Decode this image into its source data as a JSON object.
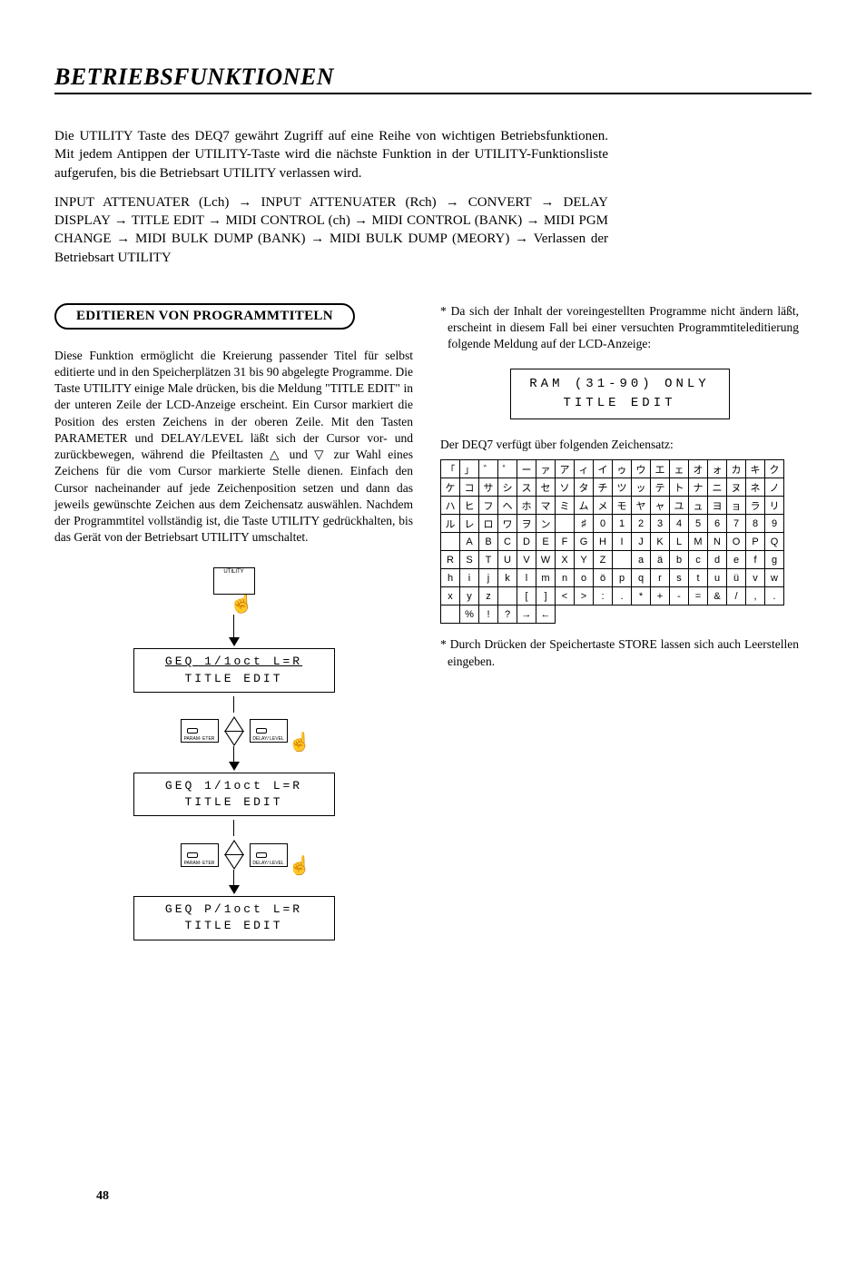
{
  "page_title": "BETRIEBSFUNKTIONEN",
  "page_number": "48",
  "intro": {
    "p1": "Die UTILITY Taste des DEQ7 gewährt Zugriff auf eine Reihe von wichtigen Betriebsfunktionen. Mit jedem Antippen der UTILITY-Taste wird die nächste Funktion in der UTILITY-Funktionsliste aufgerufen, bis die Betriebsart UTILITY verlassen wird.",
    "chain": "INPUT ATTENUATER (Lch) → INPUT ATTENUATER (Rch) → CONVERT → DELAY DISPLAY → TITLE EDIT → MIDI CONTROL (ch) → MIDI CONTROL (BANK) → MIDI PGM CHANGE → MIDI BULK DUMP (BANK) → MIDI BULK DUMP (MEORY) → Verlassen der Betriebsart UTILITY"
  },
  "section": {
    "heading": "EDITIEREN VON PROGRAMMTITELN",
    "body": "Diese Funktion ermöglicht die Kreierung passender Titel für selbst editierte und in den Speicherplätzen 31 bis 90 abgelegte Programme. Die Taste UTILITY einige Male drücken, bis die Meldung \"TITLE EDIT\" in der unteren Zeile der LCD-Anzeige erscheint. Ein Cursor markiert die Position des ersten Zeichens in der oberen Zeile. Mit den Tasten PARAMETER und DELAY/LEVEL läßt sich der Cursor vor- und zurückbewegen, während die Pfeiltasten △ und ▽ zur Wahl eines Zeichens für die vom Cursor markierte Stelle dienen. Einfach den Cursor nacheinander auf jede Zeichenposition setzen und dann das jeweils gewünschte Zeichen aus dem Zeichensatz auswählen. Nachdem der Programmtitel vollständig ist, die Taste UTILITY gedrückhalten, bis das Gerät von der Betriebsart UTILITY umschaltet."
  },
  "right": {
    "note": "* Da sich der Inhalt der voreingestellten Programme nicht ändern läßt, erscheint in diesem Fall bei einer versuchten Programmtiteleditierung folgende Meldung auf der LCD-Anzeige:",
    "lcd_line1": "RAM (31-90)  ONLY",
    "lcd_line2": "TITLE EDIT",
    "charset_intro": "Der DEQ7 verfügt über folgenden Zeichensatz:",
    "footnote": "* Durch Drücken der Speichertaste STORE lassen sich auch Leerstellen eingeben."
  },
  "charset_rows": [
    [
      "「",
      "」",
      "゛",
      "゜",
      "ー",
      "ァ",
      "ア",
      "ィ",
      "イ",
      "ゥ",
      "ウ",
      "エ",
      "ェ",
      "オ",
      "ォ",
      "カ",
      "キ",
      "ク"
    ],
    [
      "ケ",
      "コ",
      "サ",
      "シ",
      "ス",
      "セ",
      "ソ",
      "タ",
      "チ",
      "ツ",
      "ッ",
      "テ",
      "ト",
      "ナ",
      "ニ",
      "ヌ",
      "ネ",
      "ノ"
    ],
    [
      "ハ",
      "ヒ",
      "フ",
      "ヘ",
      "ホ",
      "マ",
      "ミ",
      "ム",
      "メ",
      "モ",
      "ヤ",
      "ャ",
      "ユ",
      "ュ",
      "ヨ",
      "ョ",
      "ラ",
      "リ"
    ],
    [
      "ル",
      "レ",
      "ロ",
      "ワ",
      "ヲ",
      "ン",
      "",
      "♯",
      "0",
      "1",
      "2",
      "3",
      "4",
      "5",
      "6",
      "7",
      "8",
      "9"
    ],
    [
      "",
      "A",
      "B",
      "C",
      "D",
      "E",
      "F",
      "G",
      "H",
      "I",
      "J",
      "K",
      "L",
      "M",
      "N",
      "O",
      "P",
      "Q"
    ],
    [
      "R",
      "S",
      "T",
      "U",
      "V",
      "W",
      "X",
      "Y",
      "Z",
      "",
      "a",
      "ä",
      "b",
      "c",
      "d",
      "e",
      "f",
      "g"
    ],
    [
      "h",
      "i",
      "j",
      "k",
      "l",
      "m",
      "n",
      "o",
      "ö",
      "p",
      "q",
      "r",
      "s",
      "t",
      "u",
      "ü",
      "v",
      "w"
    ],
    [
      "x",
      "y",
      "z",
      "",
      "[",
      "]",
      "<",
      ">",
      ":",
      ".",
      "*",
      "+",
      "-",
      "=",
      "&",
      "/",
      ",",
      "."
    ],
    [
      "",
      "%",
      "!",
      "?",
      "→",
      "←"
    ]
  ],
  "diagram": {
    "utility_label": "UTILITY",
    "param_label": "PARAM-\nETER",
    "delay_label": "DELAY/\nLEVEL",
    "lcd1_l1": "GEQ 1/1oct  L=R",
    "lcd1_l2": "TITLE EDIT",
    "lcd2_l1": "GEQ 1/1oct  L=R",
    "lcd2_l2": "TITLE EDIT",
    "lcd3_l1": "GEQ P/1oct  L=R",
    "lcd3_l2": "TITLE EDIT"
  }
}
